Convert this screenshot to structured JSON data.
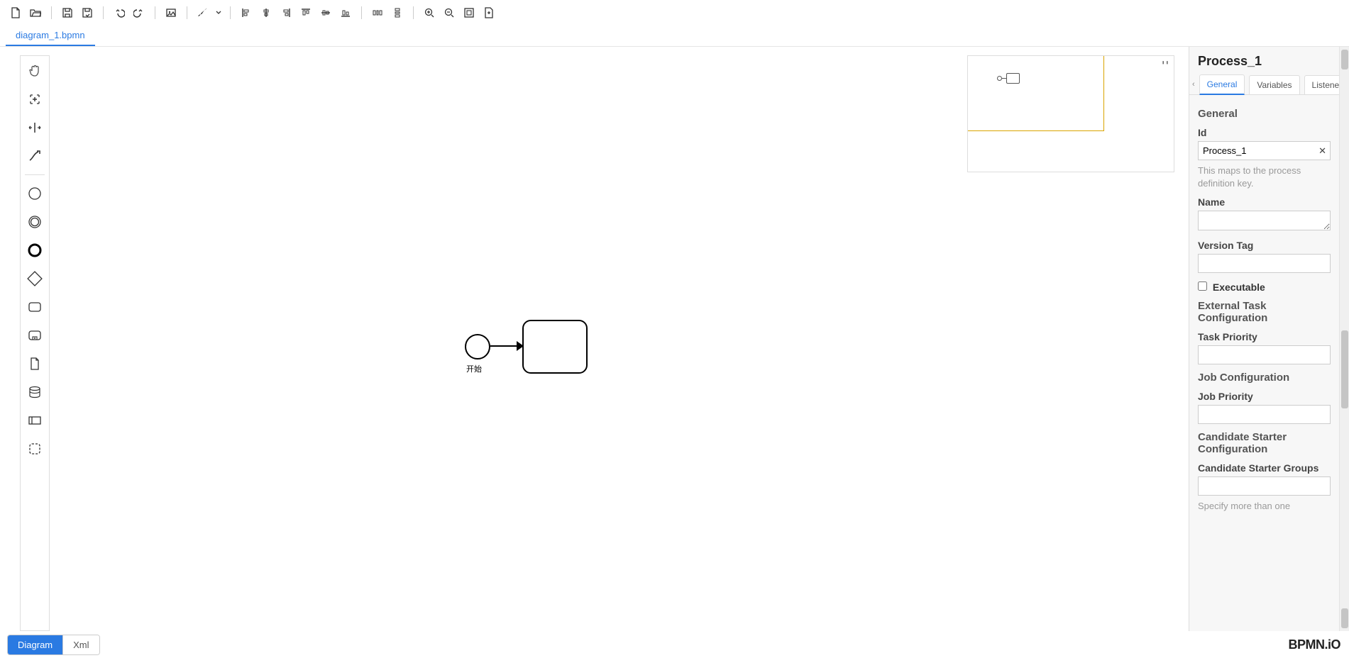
{
  "file_tabs": {
    "active": "diagram_1.bpmn"
  },
  "canvas": {
    "start_label": "开始"
  },
  "bottom": {
    "diagram": "Diagram",
    "xml": "Xml",
    "brand": "BPMN.iO"
  },
  "props": {
    "title": "Process_1",
    "tabs": {
      "general": "General",
      "variables": "Variables",
      "listeners": "Listeners"
    },
    "sections": {
      "general": "General",
      "external_task": "External Task Configuration",
      "job": "Job Configuration",
      "candidate": "Candidate Starter Configuration"
    },
    "fields": {
      "id_label": "Id",
      "id_value": "Process_1",
      "id_help": "This maps to the process definition key.",
      "name_label": "Name",
      "name_value": "",
      "version_tag_label": "Version Tag",
      "version_tag_value": "",
      "executable_label": "Executable",
      "task_priority_label": "Task Priority",
      "task_priority_value": "",
      "job_priority_label": "Job Priority",
      "job_priority_value": "",
      "cand_groups_label": "Candidate Starter Groups",
      "cand_groups_value": "",
      "cand_groups_help": "Specify more than one"
    }
  }
}
